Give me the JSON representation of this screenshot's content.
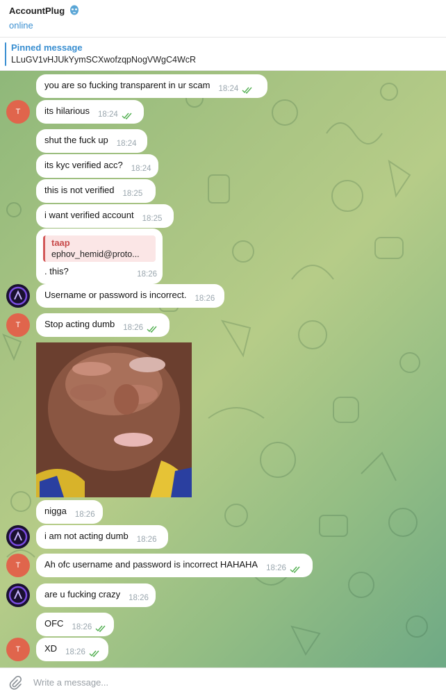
{
  "header": {
    "title": "AccountPlug",
    "status": "online",
    "title_icon": "mask-icon"
  },
  "pinned": {
    "label": "Pinned message",
    "text": "LLuGV1vHJUkYymSCXwofzqpNogVWgC4WcR"
  },
  "avatars": {
    "t_letter": "T"
  },
  "messages": [
    {
      "text": "you are so fucking transparent in ur scam",
      "time": "18:24",
      "read": true
    },
    {
      "text": "its hilarious",
      "time": "18:24",
      "read": true
    },
    {
      "text": "shut the fuck up",
      "time": "18:24"
    },
    {
      "text": "its kyc verified acc?",
      "time": "18:24"
    },
    {
      "text": "this is not verified",
      "time": "18:25"
    },
    {
      "text": "i want verified account",
      "time": "18:25"
    },
    {
      "text": "Username or password is incorrect.",
      "time": "18:26"
    },
    {
      "text": "Stop acting dumb",
      "time": "18:26",
      "read": true
    },
    {
      "text": "nigga",
      "time": "18:26"
    },
    {
      "text": "i am not acting dumb",
      "time": "18:26"
    },
    {
      "text": "Ah ofc username and password is incorrect HAHAHA",
      "time": "18:26",
      "read": true
    },
    {
      "text": "are u fucking crazy",
      "time": "18:26"
    },
    {
      "text": "OFC",
      "time": "18:26",
      "read": true
    },
    {
      "text": "XD",
      "time": "18:26",
      "read": true
    }
  ],
  "reply": {
    "quote_name": "taap",
    "quote_text": "ephov_hemid@proto...",
    "text": ". this?",
    "time": "18:26"
  },
  "composer": {
    "placeholder": "Write a message..."
  },
  "colors": {
    "accent": "#3a8fd1",
    "check": "#4fae4e",
    "avatar_t": "#e0654c",
    "avatar_dark": "#1a1030"
  }
}
